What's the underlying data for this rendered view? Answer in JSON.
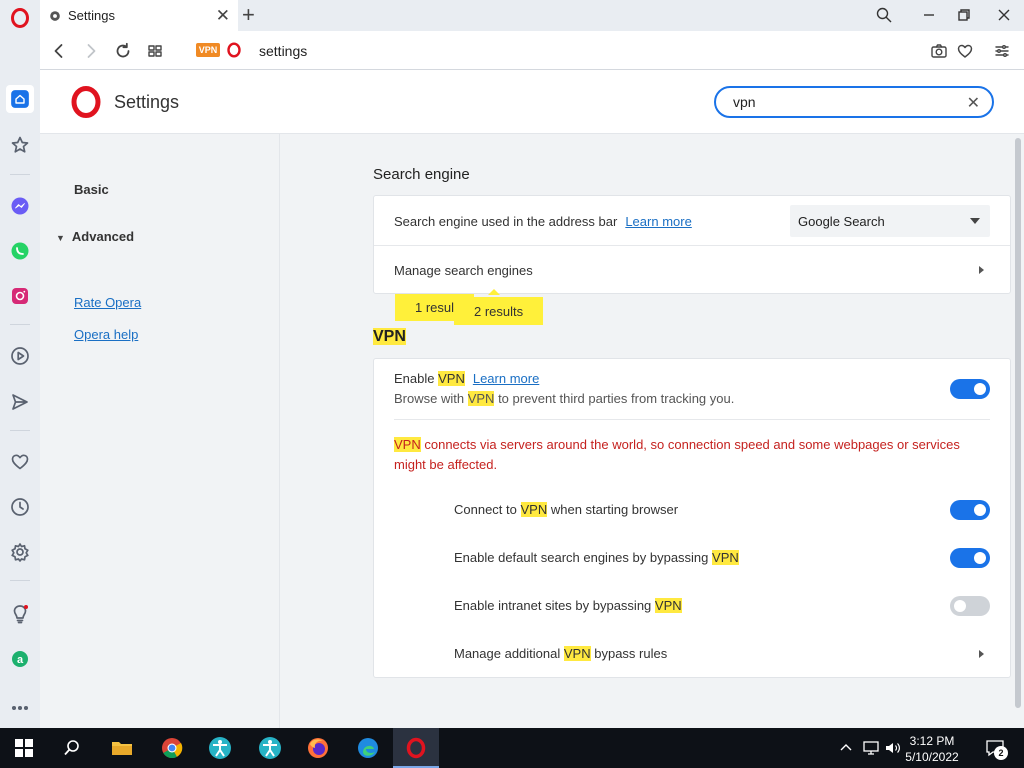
{
  "tab": {
    "title": "Settings"
  },
  "address": {
    "badge": "VPN",
    "url": "settings"
  },
  "header": {
    "title": "Settings",
    "search_value": "vpn"
  },
  "nav": {
    "basic": "Basic",
    "advanced": "Advanced",
    "rate": "Rate Opera",
    "help": "Opera help"
  },
  "search_engine": {
    "section_title": "Search engine",
    "row1_label": "Search engine used in the address bar",
    "row1_link": "Learn more",
    "dropdown_value": "Google Search",
    "row2_label": "Manage search engines",
    "bubble1": "1 resul",
    "bubble2": "2 results"
  },
  "vpn": {
    "section_title": "VPN",
    "enable_pre": "Enable",
    "vpn_word": "VPN",
    "enable_link": "Learn more",
    "desc_pre": "Browse with",
    "desc_post": "to prevent third parties from tracking you.",
    "warn_post": "connects via servers around the world, so connection speed and some webpages or services might be affected.",
    "connect_pre": "Connect to",
    "connect_post": "when starting browser",
    "bypass_search_pre": "Enable default search engines by bypassing",
    "bypass_intranet_pre": "Enable intranet sites by bypassing",
    "manage_pre": "Manage additional",
    "manage_post": "bypass rules",
    "toggles": {
      "enable": true,
      "connect_on_start": true,
      "bypass_search": true,
      "bypass_intranet": false
    }
  },
  "taskbar": {
    "time": "3:12 PM",
    "date": "5/10/2022",
    "notif_count": "2"
  },
  "colors": {
    "accent": "#1a73e8",
    "highlight": "#ffe940",
    "warning": "#c5221f",
    "opera_red": "#e0131f"
  }
}
